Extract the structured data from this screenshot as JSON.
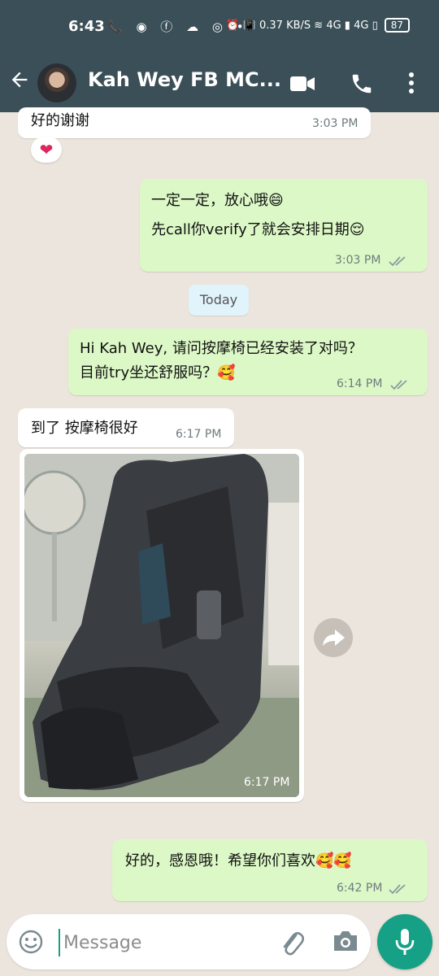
{
  "status_bar": {
    "time": "6:43",
    "left_icons": "📞 ◉ ⓕ ☁ ◎ •",
    "right_icons": "⏰ 📳 0.37 KB/S ≋ 4G ▮ 4G ▯",
    "battery": "87"
  },
  "header": {
    "contact_name": "Kah Wey FB MC..."
  },
  "messages": [
    {
      "text": "好的谢谢",
      "time": "3:03 PM",
      "reaction": "❤"
    },
    {
      "line1": "一定一定，放心哦😄",
      "line2": "先call你verify了就会安排日期😌",
      "time": "3:03 PM"
    },
    {
      "line1": "Hi Kah Wey, 请问按摩椅已经安装了对吗？",
      "line2": "目前try坐还舒服吗？🥰",
      "time": "6:14 PM"
    },
    {
      "text": "到了 按摩椅很好",
      "time": "6:17 PM"
    },
    {
      "time": "6:17 PM"
    },
    {
      "text": "好的，感恩哦！希望你们喜欢🥰🥰",
      "time": "6:42 PM"
    }
  ],
  "date_chip": "Today",
  "composer": {
    "placeholder": "Message"
  },
  "colors": {
    "header": "#3a4f57",
    "outgoing": "#dcf8c6",
    "incoming": "#ffffff",
    "accent": "#16a085"
  }
}
